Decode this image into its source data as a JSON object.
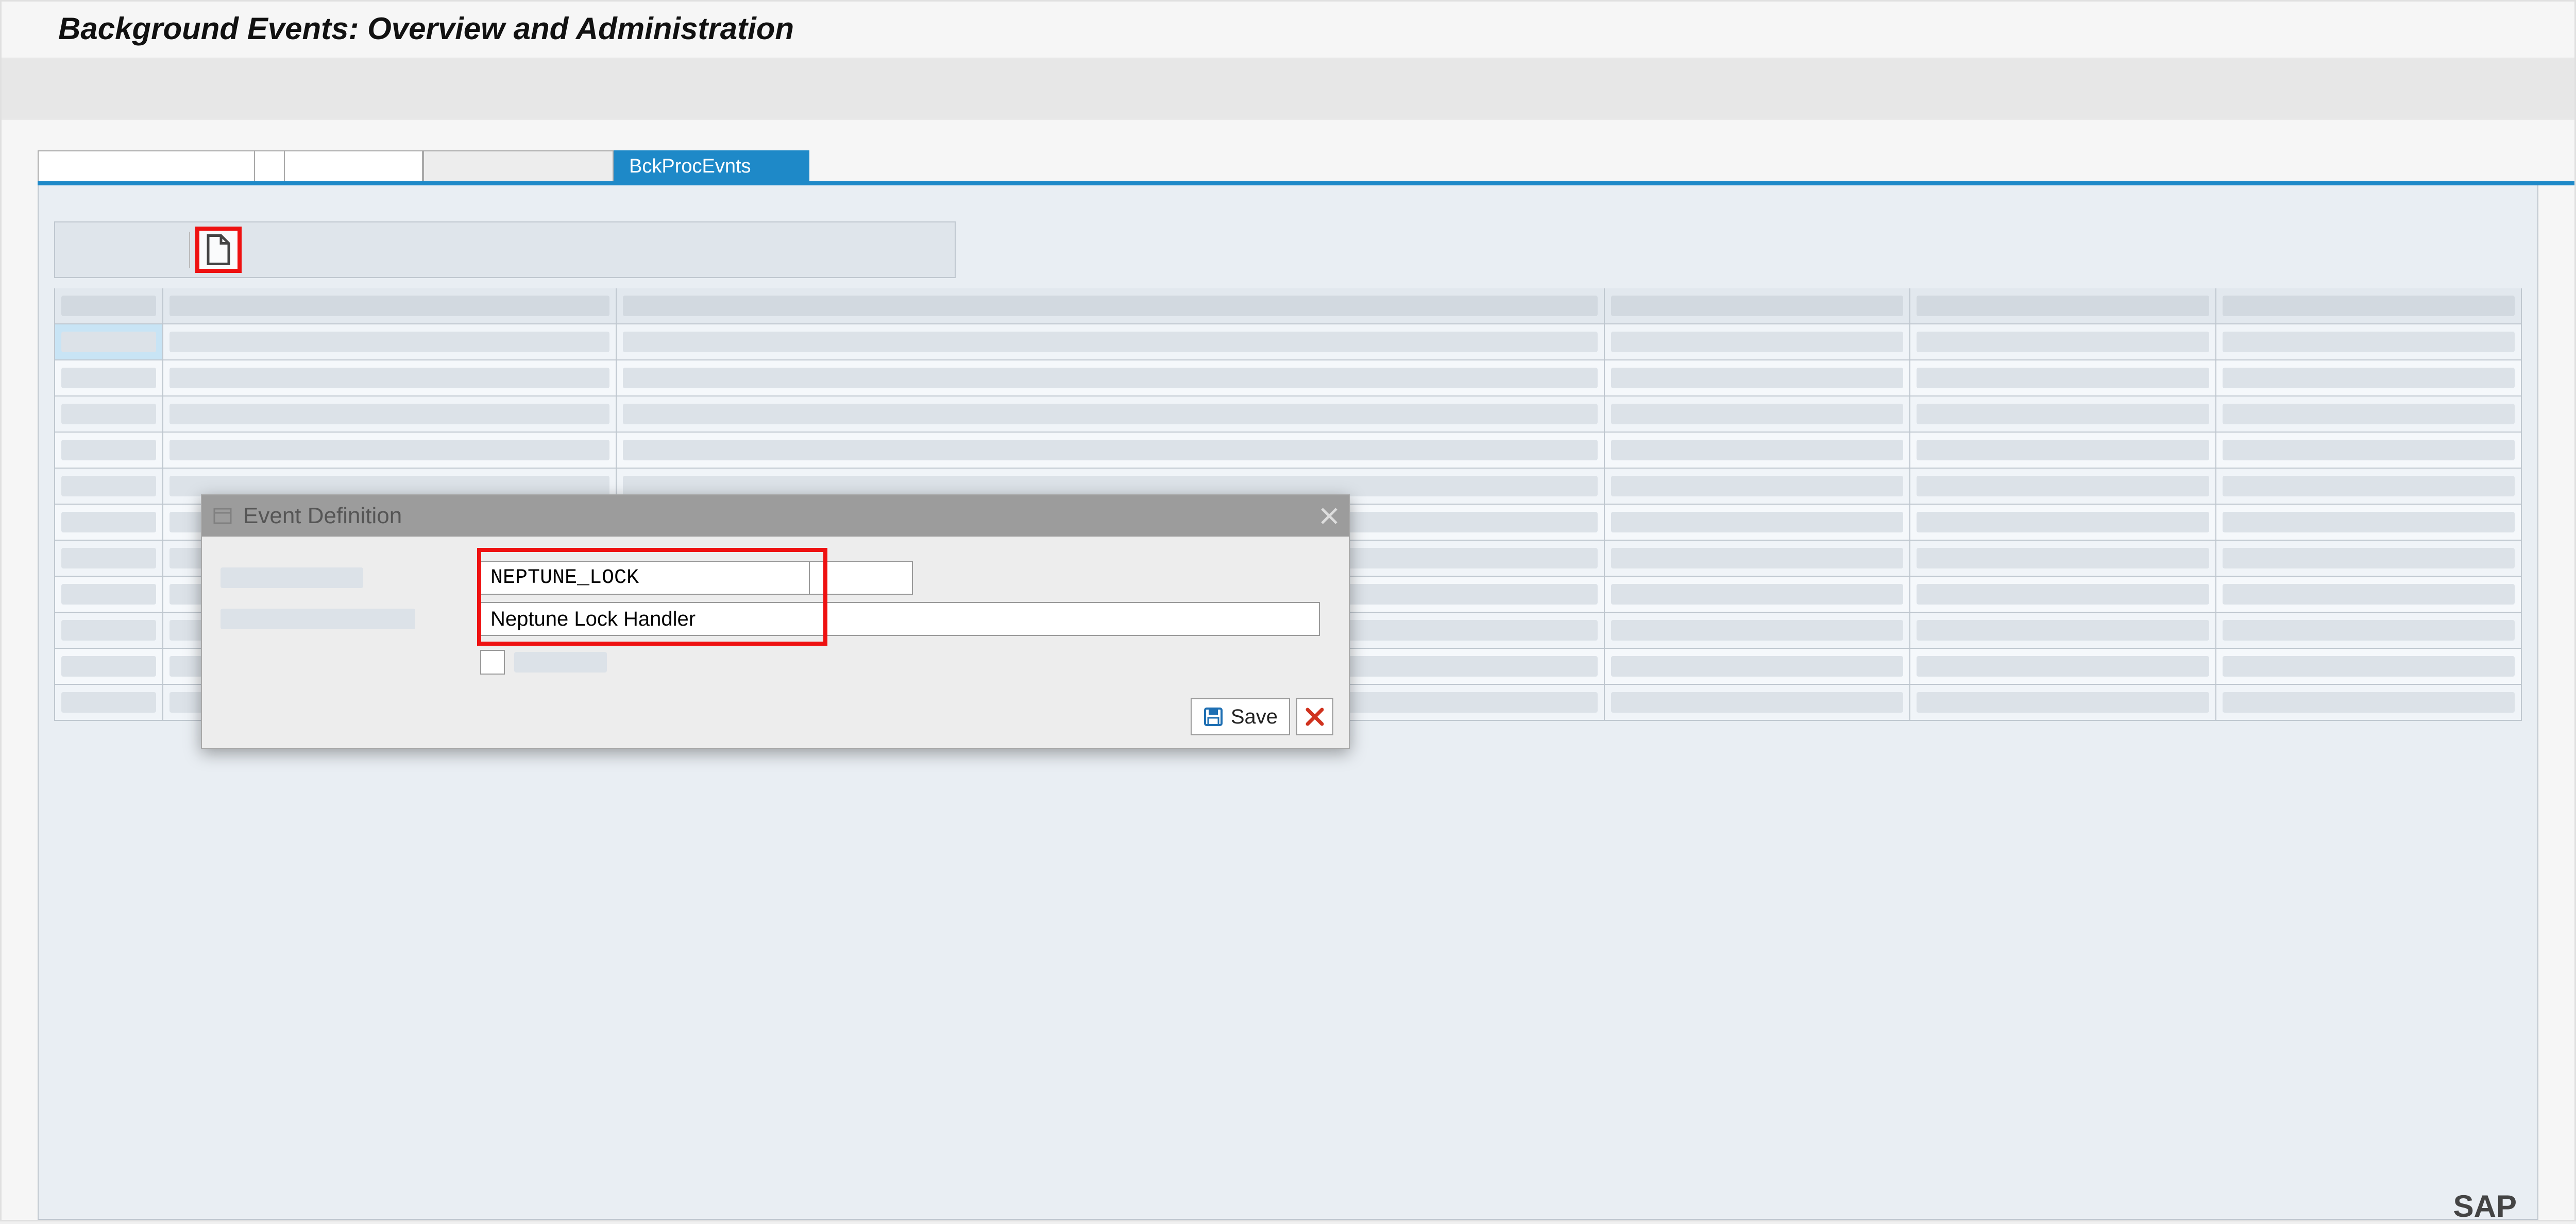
{
  "page": {
    "title": "Background Events: Overview and Administration"
  },
  "tabs": {
    "active_label": "BckProcEvnts"
  },
  "toolbar": {
    "new_button_tooltip": "Create"
  },
  "dialog": {
    "title": "Event Definition",
    "fields": {
      "event_name_value": "NEPTUNE_LOCK",
      "description_value": "Neptune Lock Handler"
    },
    "buttons": {
      "save_label": "Save"
    }
  },
  "branding": {
    "mark": "SAP"
  }
}
